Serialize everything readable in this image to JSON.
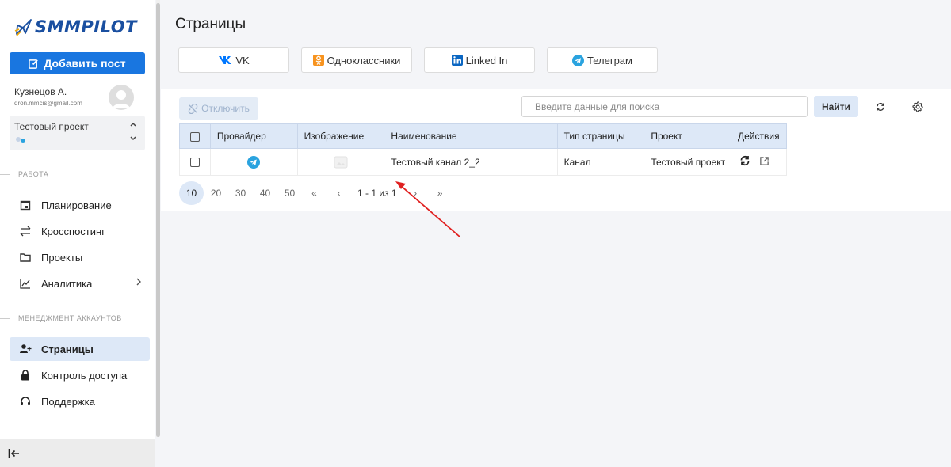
{
  "brand": {
    "name": "SMMPILOT"
  },
  "sidebar": {
    "add_post_label": "Добавить пост",
    "user": {
      "name": "Кузнецов А.",
      "email": "dron.mmcis@gmail.com"
    },
    "project": {
      "name": "Тестовый проект"
    },
    "sections": [
      {
        "label": "РАБОТА"
      },
      {
        "label": "МЕНЕДЖМЕНТ АККАУНТОВ"
      }
    ],
    "work_items": [
      {
        "label": "Планирование",
        "icon": "calendar-icon"
      },
      {
        "label": "Кросспостинг",
        "icon": "swap-arrows-icon"
      },
      {
        "label": "Проекты",
        "icon": "folder-icon"
      },
      {
        "label": "Аналитика",
        "icon": "chart-icon"
      }
    ],
    "account_items": [
      {
        "label": "Страницы",
        "icon": "user-plus-icon",
        "active": true
      },
      {
        "label": "Контроль доступа",
        "icon": "lock-icon"
      },
      {
        "label": "Поддержка",
        "icon": "headset-icon"
      }
    ]
  },
  "main": {
    "title": "Страницы",
    "provider_tabs": [
      {
        "label": "VK",
        "icon": "vk-icon",
        "color": "#0077ff"
      },
      {
        "label": "Одноклассники",
        "icon": "odnoklassniki-icon",
        "color": "#f7931e"
      },
      {
        "label": "Linked In",
        "icon": "linkedin-icon",
        "color": "#0a66c2"
      },
      {
        "label": "Телеграм",
        "icon": "telegram-icon",
        "color": "#2aa3df"
      }
    ],
    "toolbar": {
      "disconnect_label": "Отключить",
      "search_placeholder": "Введите данные для поиска",
      "find_label": "Найти"
    },
    "table": {
      "columns": [
        "Провайдер",
        "Изображение",
        "Наименование",
        "Тип страницы",
        "Проект",
        "Действия"
      ],
      "rows": [
        {
          "provider": "telegram-icon",
          "name": "Тестовый канал 2_2",
          "type": "Канал",
          "project": "Тестовый проект"
        }
      ]
    },
    "pagination": {
      "sizes": [
        "10",
        "20",
        "30",
        "40",
        "50"
      ],
      "active_size": "10",
      "first": "«",
      "prev": "‹",
      "info": "1 - 1 из 1",
      "next": "›",
      "last": "»"
    }
  },
  "colors": {
    "accent": "#1976e0",
    "header_bg": "#dde8f7",
    "annotation_arrow": "#e02020"
  }
}
